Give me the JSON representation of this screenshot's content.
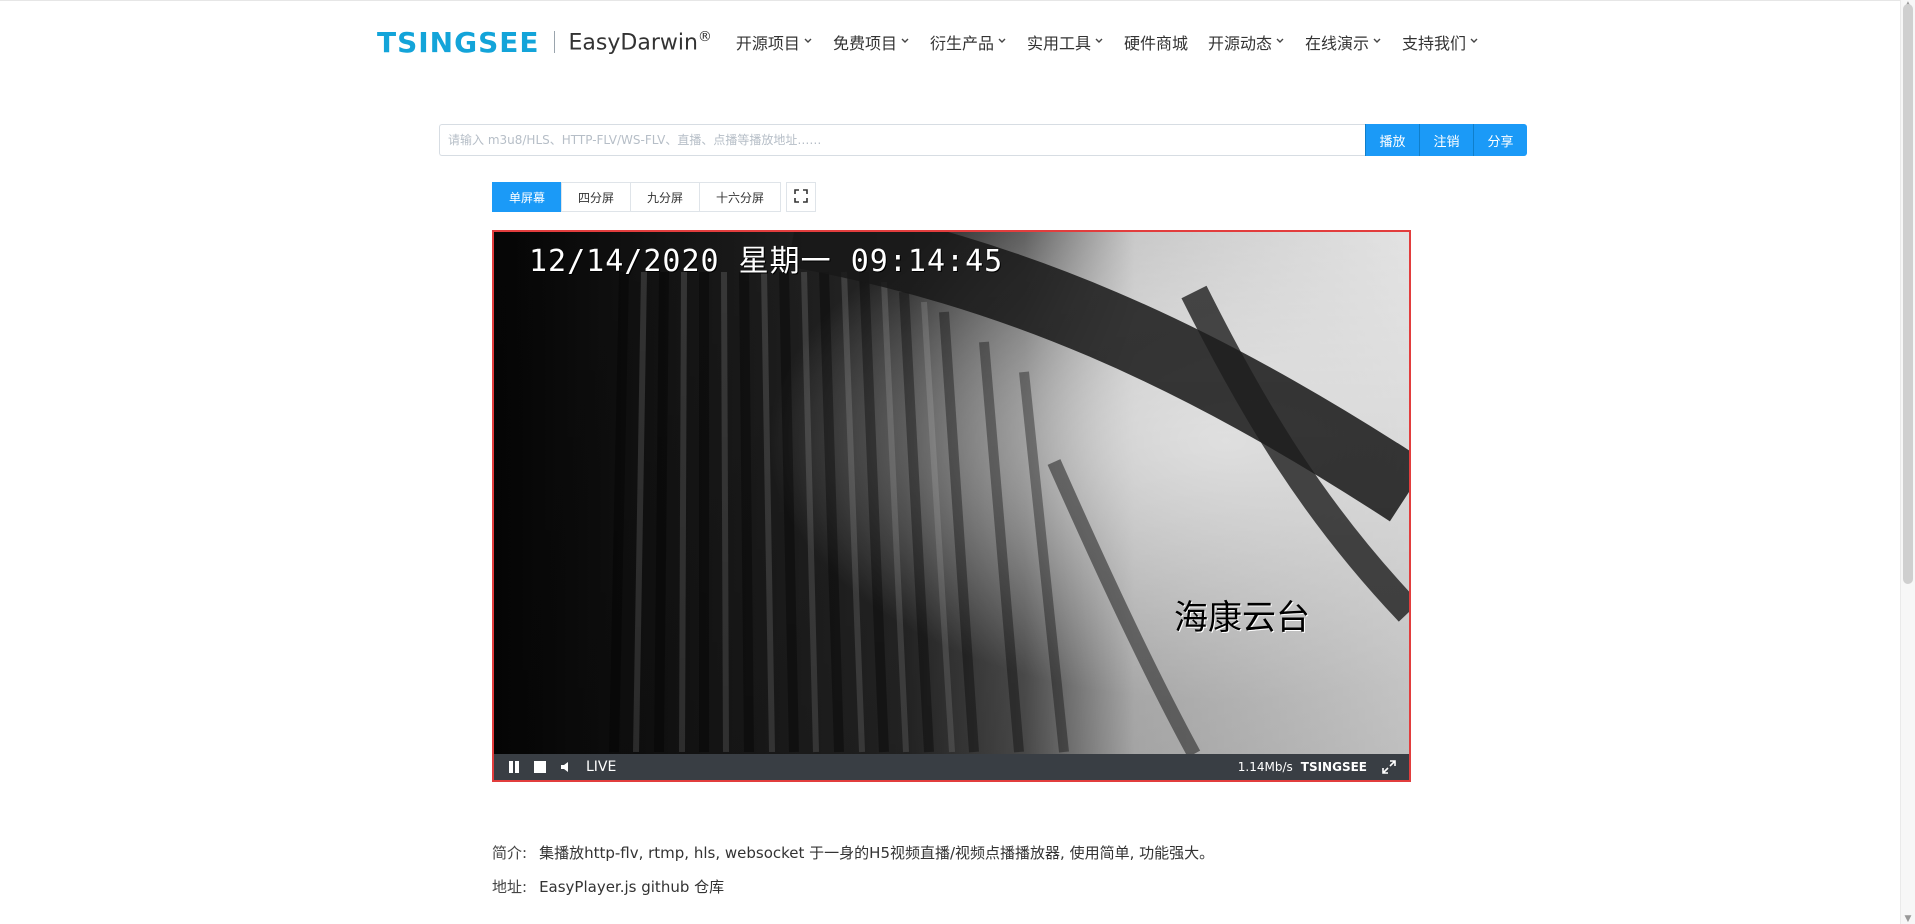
{
  "header": {
    "logo_text": "TSINGSEE",
    "product": "EasyDarwin",
    "product_suffix": "®",
    "nav": [
      {
        "label": "开源项目",
        "has_menu": true
      },
      {
        "label": "免费项目",
        "has_menu": true
      },
      {
        "label": "衍生产品",
        "has_menu": true
      },
      {
        "label": "实用工具",
        "has_menu": true
      },
      {
        "label": "硬件商城",
        "has_menu": false
      },
      {
        "label": "开源动态",
        "has_menu": true
      },
      {
        "label": "在线演示",
        "has_menu": true
      },
      {
        "label": "支持我们",
        "has_menu": true
      }
    ]
  },
  "search": {
    "placeholder": "请输入 m3u8/HLS、HTTP-FLV/WS-FLV、直播、点播等播放地址……",
    "value": "",
    "buttons": [
      "播放",
      "注销",
      "分享"
    ]
  },
  "tabs": {
    "items": [
      "单屏幕",
      "四分屏",
      "九分屏",
      "十六分屏"
    ],
    "active_index": 0
  },
  "player": {
    "osd_datetime": "12/14/2020 星期一 09:14:45",
    "osd_label": "海康云台",
    "live_text": "LIVE",
    "bitrate": "1.14Mb/s",
    "brand": "TSINGSEE",
    "icons": [
      "pause-icon",
      "stop-icon",
      "volume-icon",
      "fullscreen-icon"
    ]
  },
  "info": {
    "intro_label": "简介:",
    "intro_text": "集播放http-flv, rtmp, hls, websocket 于一身的H5视频直播/视频点播播放器, 使用简单, 功能强大。",
    "address_label": "地址:",
    "address_link": "EasyPlayer.js github 仓库"
  },
  "colors": {
    "brand": "#13a4d9",
    "accent": "#1b9af7",
    "player_border": "#e23d3d",
    "controls_bg": "#3c4148"
  }
}
